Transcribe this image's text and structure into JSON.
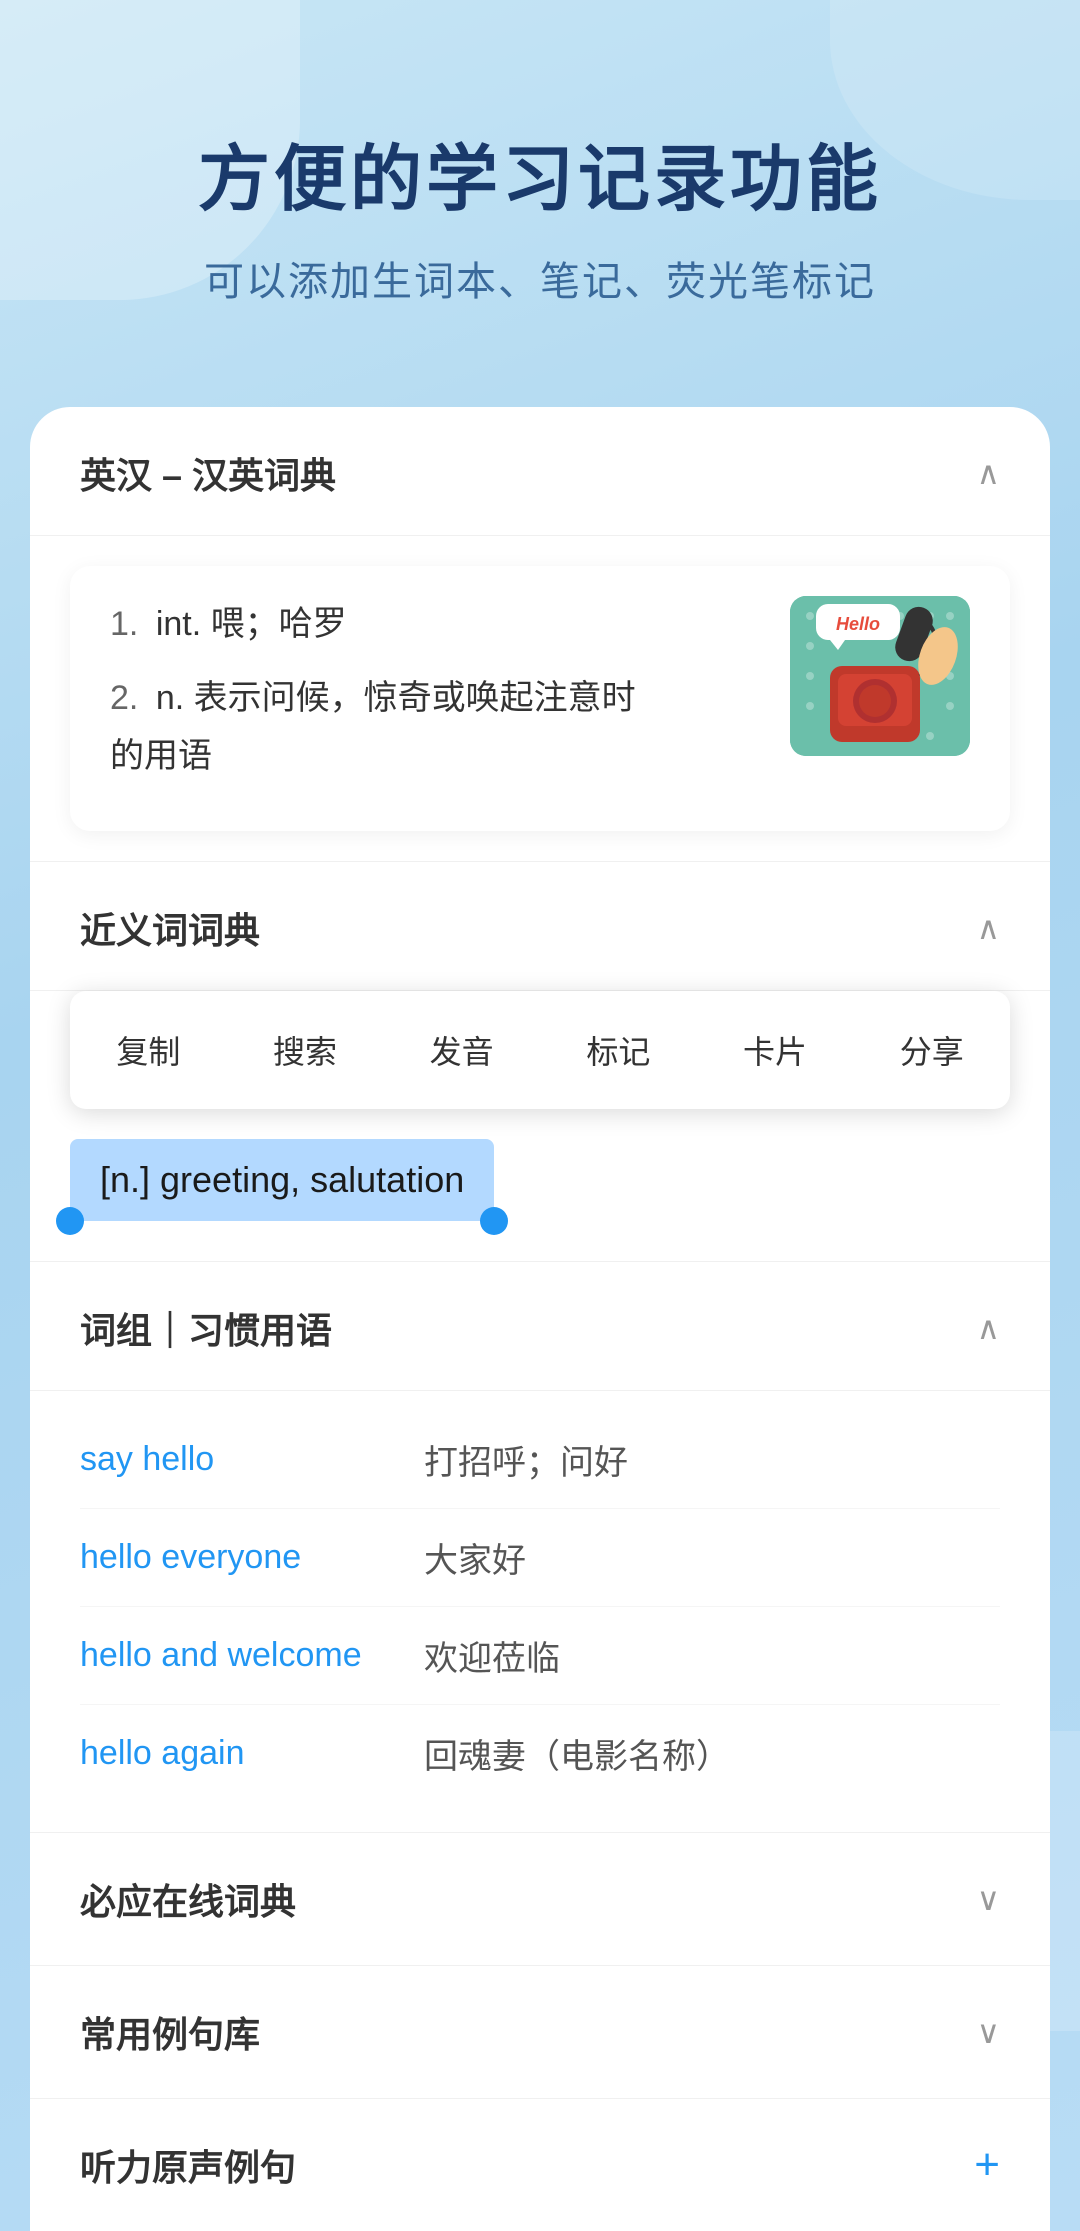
{
  "header": {
    "title": "方便的学习记录功能",
    "subtitle": "可以添加生词本、笔记、荧光笔标记"
  },
  "dict_section": {
    "title": "英汉 – 汉英词典",
    "chevron": "∧",
    "definitions": [
      {
        "num": "1.",
        "type": "int.",
        "text": "喂；哈罗"
      },
      {
        "num": "2.",
        "type": "n.",
        "text": "表示问候，惊奇或唤起注意时的用语"
      }
    ],
    "image_label": "Hello telephone illustration"
  },
  "synonyms_section": {
    "title": "近义词词典",
    "chevron": "∧",
    "context_menu": {
      "items": [
        "复制",
        "搜索",
        "发音",
        "标记",
        "卡片",
        "分享"
      ]
    },
    "highlighted_text": "[n.] greeting, salutation"
  },
  "phrases_section": {
    "title": "词组｜习惯用语",
    "chevron": "∧",
    "phrases": [
      {
        "english": "say hello",
        "chinese": "打招呼；问好"
      },
      {
        "english": "hello everyone",
        "chinese": "大家好"
      },
      {
        "english": "hello and welcome",
        "chinese": "欢迎莅临"
      },
      {
        "english": "hello again",
        "chinese": "回魂妻（电影名称）"
      }
    ]
  },
  "collapsed_sections": [
    {
      "title": "必应在线词典",
      "icon": "chevron-down",
      "icon_char": "∨"
    },
    {
      "title": "常用例句库",
      "icon": "chevron-down",
      "icon_char": "∨"
    },
    {
      "title": "听力原声例句",
      "icon": "plus",
      "icon_char": "+"
    }
  ]
}
